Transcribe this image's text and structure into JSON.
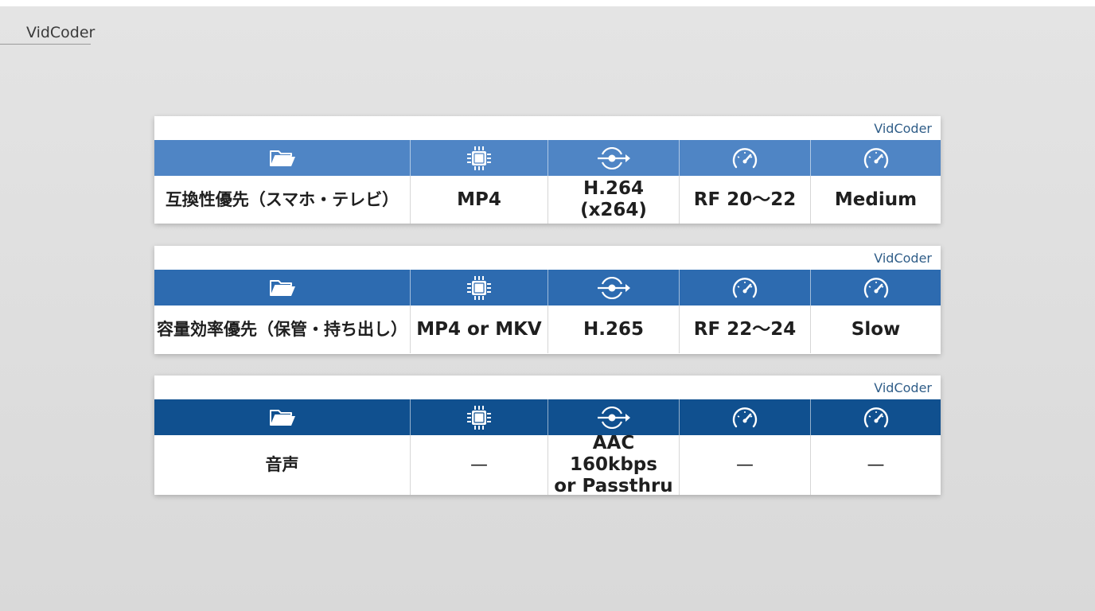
{
  "app": {
    "title": "VidCoder"
  },
  "colors": {
    "row1_band": "#4f85c5",
    "row2_band": "#2d6bb0",
    "row3_band": "#10508f",
    "icon": "#ffffff",
    "brand_text": "#2f5d88"
  },
  "icons": [
    "folder-icon",
    "chip-icon",
    "codec-arrow-icon",
    "gauge-icon",
    "gauge-icon"
  ],
  "cards": [
    {
      "brand": "VidCoder",
      "values": [
        "互換性優先（スマホ・テレビ）",
        "MP4",
        "H.264 (x264)",
        "RF 20〜22",
        "Medium"
      ]
    },
    {
      "brand": "VidCoder",
      "values": [
        "容量効率優先（保管・持ち出し）",
        "MP4 or MKV",
        "H.265",
        "RF 22〜24",
        "Slow"
      ]
    },
    {
      "brand": "VidCoder",
      "values": [
        "音声",
        "—",
        "AAC 160kbps\nor Passthru",
        "—",
        "—"
      ]
    }
  ]
}
